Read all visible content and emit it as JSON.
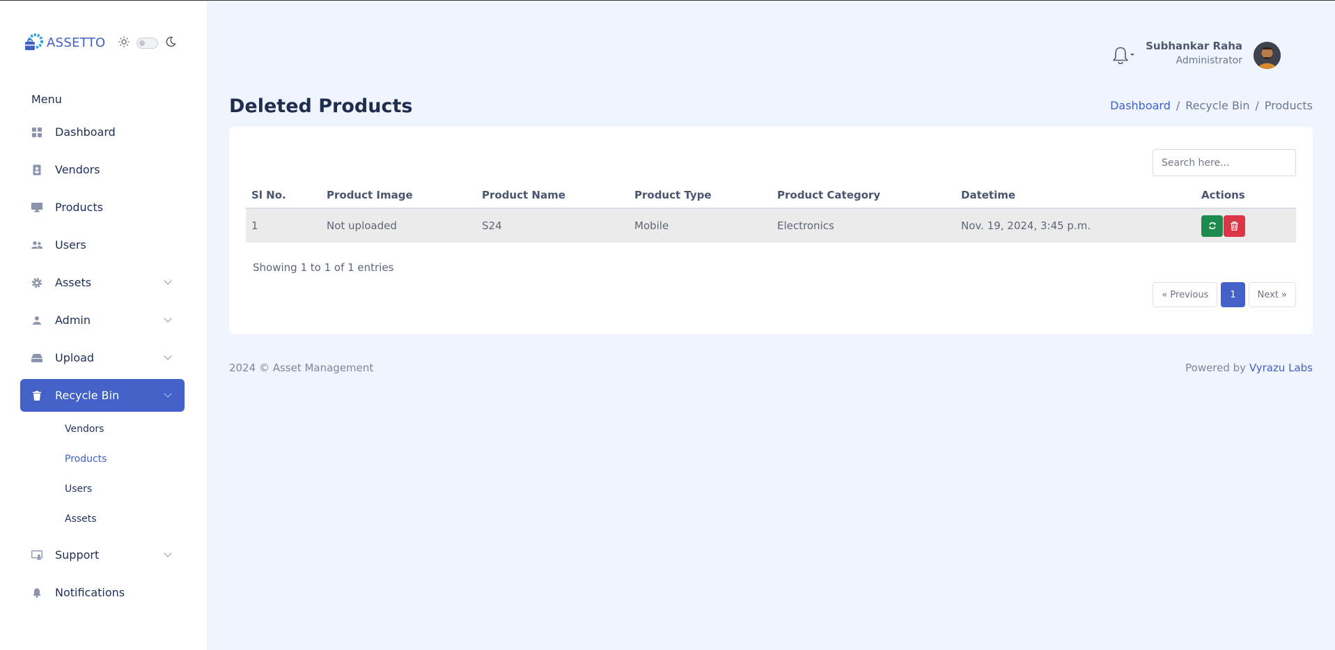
{
  "brand": {
    "name": "ASSETTO"
  },
  "sidebar": {
    "menu_title": "Menu",
    "items": [
      {
        "label": "Dashboard",
        "icon": "grid-icon"
      },
      {
        "label": "Vendors",
        "icon": "contact-card-icon"
      },
      {
        "label": "Products",
        "icon": "monitor-icon"
      },
      {
        "label": "Users",
        "icon": "users-icon"
      },
      {
        "label": "Assets",
        "icon": "gear-icon"
      },
      {
        "label": "Admin",
        "icon": "user-icon"
      },
      {
        "label": "Upload",
        "icon": "drive-icon"
      },
      {
        "label": "Recycle Bin",
        "icon": "trash-icon"
      },
      {
        "label": "Support",
        "icon": "support-icon"
      },
      {
        "label": "Notifications",
        "icon": "bell-icon"
      }
    ],
    "recycle_sub": [
      "Vendors",
      "Products",
      "Users",
      "Assets"
    ]
  },
  "header": {
    "user_name": "Subhankar Raha",
    "user_role": "Administrator"
  },
  "page": {
    "title": "Deleted Products",
    "breadcrumb": [
      "Dashboard",
      "Recycle Bin",
      "Products"
    ],
    "breadcrumb_sep": "/"
  },
  "table": {
    "search_placeholder": "Search here...",
    "columns": [
      "Sl No.",
      "Product Image",
      "Product Name",
      "Product Type",
      "Product Category",
      "Datetime",
      "Actions"
    ],
    "rows": [
      [
        "1",
        "Not uploaded",
        "S24",
        "Mobile",
        "Electronics",
        "Nov. 19, 2024, 3:45 p.m."
      ]
    ],
    "info": "Showing 1 to 1 of 1 entries",
    "pager": {
      "prev": "« Previous",
      "current": "1",
      "next": "Next »"
    }
  },
  "footer": {
    "copyright": "2024 © Asset Management",
    "powered_prefix": "Powered by",
    "powered_link": "Vyrazu Labs"
  },
  "colors": {
    "accent": "#4361c8",
    "restore": "#1c8b4d",
    "delete": "#dc3545"
  }
}
